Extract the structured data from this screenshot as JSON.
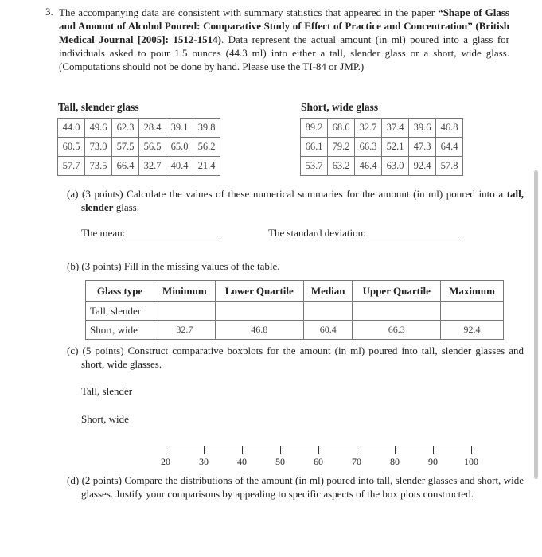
{
  "problem": {
    "number": "3.",
    "intro_pre": "The accompanying data are consistent with summary statistics that appeared in the paper ",
    "intro_bold": "“Shape of Glass and Amount of Alcohol Poured: Comparative Study of Effect of Practice and Concentration” (British Medical Journal [2005]: 1512-1514)",
    "intro_post": ". Data represent the actual amount (in ml) poured into a glass for individuals asked to pour 1.5 ounces (44.3 ml) into either a tall, slender glass or a short, wide glass. (Computations should not be done by hand. Please use the TI-84 or JMP.)"
  },
  "tall_table": {
    "title": "Tall, slender glass",
    "rows": [
      [
        "44.0",
        "49.6",
        "62.3",
        "28.4",
        "39.1",
        "39.8"
      ],
      [
        "60.5",
        "73.0",
        "57.5",
        "56.5",
        "65.0",
        "56.2"
      ],
      [
        "57.7",
        "73.5",
        "66.4",
        "32.7",
        "40.4",
        "21.4"
      ]
    ]
  },
  "short_table": {
    "title": "Short, wide glass",
    "rows": [
      [
        "89.2",
        "68.6",
        "32.7",
        "37.4",
        "39.6",
        "46.8"
      ],
      [
        "66.1",
        "79.2",
        "66.3",
        "52.1",
        "47.3",
        "64.4"
      ],
      [
        "53.7",
        "63.2",
        "46.4",
        "63.0",
        "92.4",
        "57.8"
      ]
    ]
  },
  "part_a": {
    "pre": "(a) (3 points) Calculate the values of these numerical summaries for the amount (in ml) poured into a ",
    "bold": "tall, slender",
    "post": " glass.",
    "mean_label": "The mean:",
    "sd_label": "The standard deviation:"
  },
  "part_b": {
    "text": "(b) (3 points) Fill in the missing values of the table.",
    "headers": [
      "Glass type",
      "Minimum",
      "Lower Quartile",
      "Median",
      "Upper Quartile",
      "Maximum"
    ],
    "rows": [
      [
        "Tall, slender",
        "",
        "",
        "",
        "",
        ""
      ],
      [
        "Short, wide",
        "32.7",
        "46.8",
        "60.4",
        "66.3",
        "92.4"
      ]
    ]
  },
  "part_c": {
    "text": "(c) (5 points) Construct comparative boxplots for the amount (in ml) poured into tall, slender glasses and short, wide glasses.",
    "label_tall": "Tall, slender",
    "label_short": "Short, wide",
    "axis_ticks": [
      "20",
      "30",
      "40",
      "50",
      "60",
      "70",
      "80",
      "90",
      "100"
    ]
  },
  "part_d": {
    "text": "(d) (2 points) Compare the distributions of the amount (in ml) poured into tall, slender glasses and short, wide glasses. Justify your comparisons by appealing to specific aspects of the box plots constructed."
  }
}
